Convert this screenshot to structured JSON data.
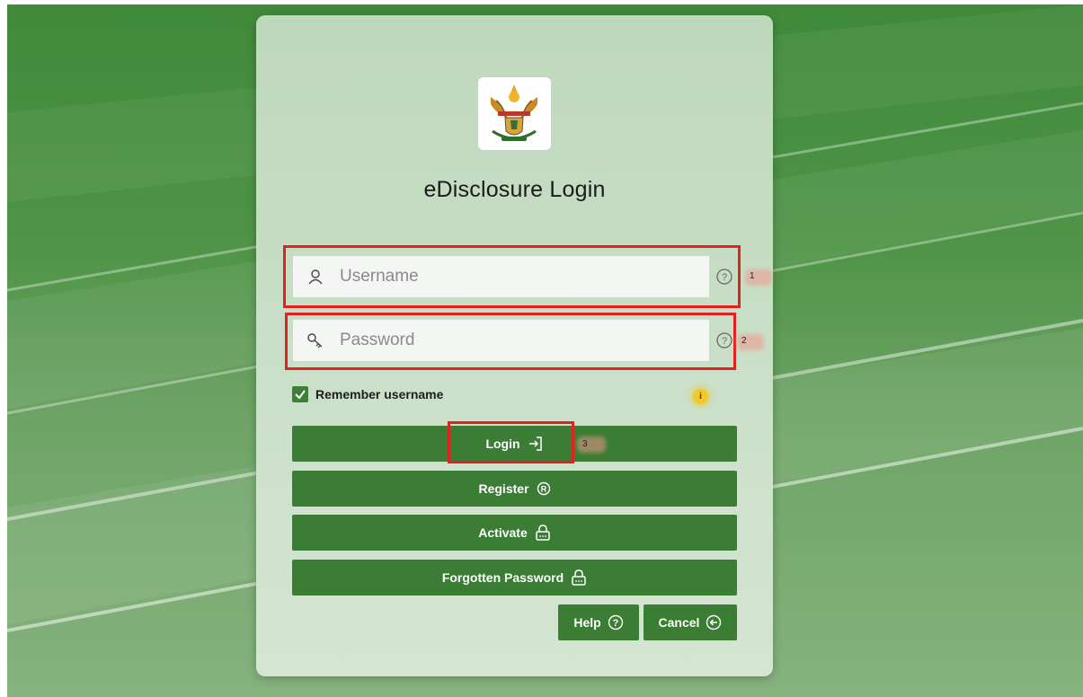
{
  "page": {
    "title": "eDisclosure Login"
  },
  "form": {
    "username_placeholder": "Username",
    "password_placeholder": "Password",
    "remember_label": "Remember username",
    "remember_checked": true,
    "info_glyph": "i"
  },
  "buttons": {
    "login": "Login",
    "register": "Register",
    "activate": "Activate",
    "forgotten": "Forgotten Password",
    "help": "Help",
    "cancel": "Cancel"
  },
  "annotations": {
    "marker1": "1",
    "marker2": "2",
    "marker3": "3"
  },
  "icons": {
    "logo": "coat-of-arms-logo",
    "username": "user-icon",
    "password": "key-icon",
    "help": "question-circle-icon",
    "login": "sign-in-icon",
    "register": "registered-icon",
    "lock": "lock-icon",
    "cancel": "arrow-left-circle-icon"
  },
  "colors": {
    "primary_button": "#3b7d34",
    "card_background": "#c5dcc3",
    "annotation_box": "#e0231f",
    "info_badge": "#f3c92a"
  }
}
